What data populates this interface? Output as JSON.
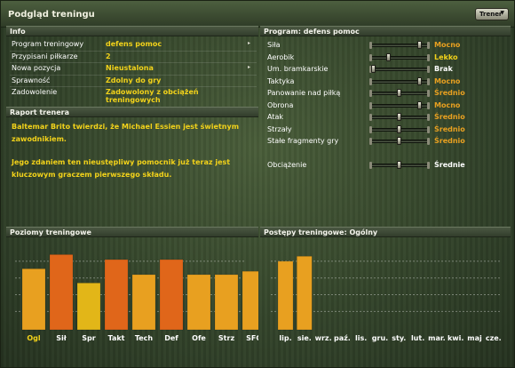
{
  "window": {
    "title": "Podgląd treningu",
    "coach_button": "Trener"
  },
  "info": {
    "header": "Info",
    "rows": [
      {
        "label": "Program treningowy",
        "value": "defens pomoc",
        "has_arrow": true
      },
      {
        "label": "Przypisani piłkarze",
        "value": "2",
        "has_arrow": false
      },
      {
        "label": "Nowa pozycja",
        "value": "Nieustalona",
        "has_arrow": true
      },
      {
        "label": "Sprawność",
        "value": "Zdolny do gry",
        "has_arrow": false
      },
      {
        "label": "Zadowolenie",
        "value": "Zadowolony z obciążeń treningowych",
        "has_arrow": false
      }
    ]
  },
  "report": {
    "header": "Raport trenera",
    "paragraphs": [
      "Baltemar Brito twierdzi, że Michael Essien jest świetnym zawodnikiem.",
      "Jego zdaniem ten nieustępliwy pomocnik już teraz jest kluczowym graczem pierwszego składu."
    ]
  },
  "program": {
    "header": "Program: defens pomoc",
    "items": [
      {
        "label": "Siła",
        "level": "Mocno",
        "color": "#e8a020",
        "fraction": 0.9
      },
      {
        "label": "Aerobik",
        "level": "Lekko",
        "color": "#f2d21a",
        "fraction": 0.3
      },
      {
        "label": "Um. bramkarskie",
        "level": "Brak",
        "color": "#ffffff",
        "fraction": 0.0
      },
      {
        "label": "Taktyka",
        "level": "Mocno",
        "color": "#e8a020",
        "fraction": 0.9
      },
      {
        "label": "Panowanie nad piłką",
        "level": "Średnio",
        "color": "#e8a020",
        "fraction": 0.5
      },
      {
        "label": "Obrona",
        "level": "Mocno",
        "color": "#e8a020",
        "fraction": 0.9
      },
      {
        "label": "Atak",
        "level": "Średnio",
        "color": "#e8a020",
        "fraction": 0.5
      },
      {
        "label": "Strzały",
        "level": "Średnio",
        "color": "#e8a020",
        "fraction": 0.5
      },
      {
        "label": "Stałe fragmenty gry",
        "level": "Średnio",
        "color": "#e8a020",
        "fraction": 0.5
      }
    ],
    "workload": {
      "label": "Obciążenie",
      "level": "Średnie",
      "color": "#ffffff",
      "fraction": 0.5
    }
  },
  "levels_chart": {
    "header": "Poziomy treningowe",
    "chart_data": {
      "type": "bar",
      "categories": [
        "Ogl",
        "Sił",
        "Spr",
        "Takt",
        "Tech",
        "Def",
        "Ofe",
        "Strz",
        "SFG"
      ],
      "values": [
        73,
        90,
        56,
        84,
        66,
        84,
        66,
        66,
        70
      ],
      "colors": [
        "#e8a020",
        "#e0661a",
        "#e2b618",
        "#e0661a",
        "#e8a020",
        "#e0661a",
        "#e8a020",
        "#e8a020",
        "#e8a020"
      ],
      "category_colors": [
        "#f2d21a",
        "#ffffff",
        "#ffffff",
        "#ffffff",
        "#ffffff",
        "#ffffff",
        "#ffffff",
        "#ffffff",
        "#ffffff"
      ],
      "ylim": [
        0,
        100
      ]
    }
  },
  "progress_chart": {
    "header": "Postępy treningowe: Ogólny",
    "chart_data": {
      "type": "bar",
      "categories": [
        "lip.",
        "sie.",
        "wrz.",
        "paź.",
        "lis.",
        "gru.",
        "sty.",
        "lut.",
        "mar.",
        "kwi.",
        "maj",
        "cze."
      ],
      "values": [
        82,
        88,
        null,
        null,
        null,
        null,
        null,
        null,
        null,
        null,
        null,
        null
      ],
      "color": "#e8a020",
      "ylim": [
        0,
        100
      ]
    }
  }
}
